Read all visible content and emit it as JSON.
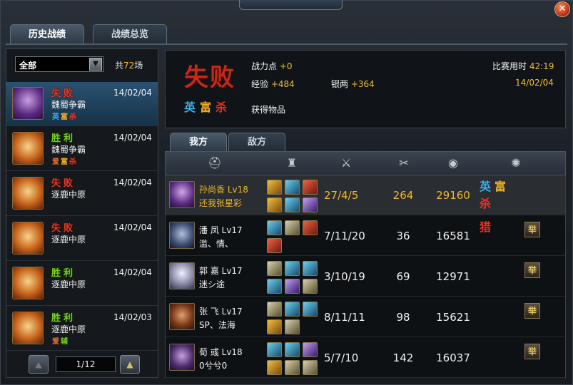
{
  "window": {
    "title": ""
  },
  "tabs": {
    "history": "历史战绩",
    "overview": "战绩总览"
  },
  "filter": {
    "value": "全部",
    "total_prefix": "共",
    "total_count": "72",
    "total_suffix": "场"
  },
  "matches": [
    {
      "result": "失败",
      "mode": "魏蜀争霸",
      "date": "14/02/04",
      "badges": [
        "英",
        "富",
        "杀"
      ]
    },
    {
      "result": "胜利",
      "mode": "魏蜀争霸",
      "date": "14/02/04",
      "badges": [
        "爱",
        "富",
        "杀"
      ]
    },
    {
      "result": "失败",
      "mode": "逐鹿中原",
      "date": "14/02/04",
      "badges": []
    },
    {
      "result": "失败",
      "mode": "逐鹿中原",
      "date": "14/02/04",
      "badges": []
    },
    {
      "result": "胜利",
      "mode": "逐鹿中原",
      "date": "14/02/04",
      "badges": []
    },
    {
      "result": "胜利",
      "mode": "逐鹿中原",
      "date": "14/02/03",
      "badges": [
        "爱",
        "辅"
      ]
    }
  ],
  "pager": {
    "page": "1/12"
  },
  "summary": {
    "result": "失败",
    "badges": [
      "英",
      "富",
      "杀"
    ],
    "power_label": "战力点",
    "power_value": "+0",
    "exp_label": "经验",
    "exp_value": "+484",
    "silver_label": "银两",
    "silver_value": "+364",
    "time_label": "比赛用时",
    "time_value": "42:19",
    "date": "14/02/04",
    "items_label": "获得物品"
  },
  "team_tabs": {
    "mine": "我方",
    "enemy": "敌方"
  },
  "players": [
    {
      "name": "孙尚香 Lv18",
      "sub": "还我张星彩",
      "kda": "27/4/5",
      "damage": "264",
      "silver": "29160",
      "badges": [
        "英",
        "富",
        "杀"
      ],
      "friend": false
    },
    {
      "name": "潘 凤 Lv17",
      "sub": "滥、情、",
      "kda": "7/11/20",
      "damage": "36",
      "silver": "16581",
      "badges": [
        "猎"
      ],
      "friend": true
    },
    {
      "name": "郭 嘉 Lv17",
      "sub": "迷シ途",
      "kda": "3/10/19",
      "damage": "69",
      "silver": "12971",
      "badges": [],
      "friend": true
    },
    {
      "name": "张 飞 Lv17",
      "sub": "SP、法海",
      "kda": "8/11/11",
      "damage": "98",
      "silver": "15621",
      "badges": [],
      "friend": true
    },
    {
      "name": "荀 彧 Lv18",
      "sub": "0兮兮0",
      "kda": "5/7/10",
      "damage": "142",
      "silver": "16037",
      "badges": [],
      "friend": true
    }
  ],
  "add_friend_label": "举",
  "colors": {
    "accent_gold": "#f0c030",
    "lose_red": "#e03a20",
    "win_green": "#78d018"
  }
}
